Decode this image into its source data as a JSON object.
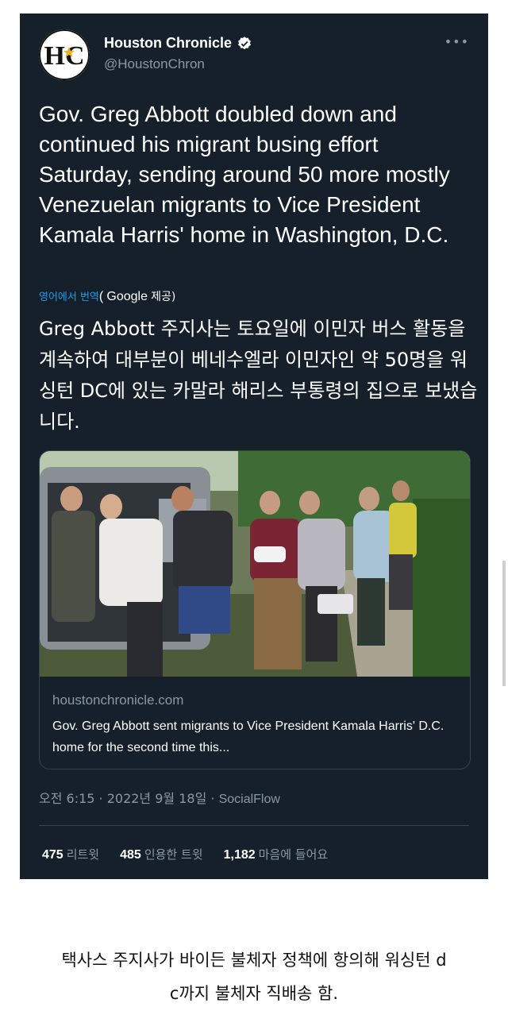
{
  "tweet": {
    "display_name": "Houston Chronicle",
    "handle": "@HoustonChron",
    "more_icon": "more-horizontal-icon",
    "avatar_text": "HC",
    "text": "Gov. Greg Abbott doubled down and continued his migrant busing effort Saturday, sending around 50 more mostly Venezuelan migrants to Vice President Kamala Harris' home in Washington, D.C.",
    "translate_label": "영어에서 번역",
    "translate_provider_open": "(",
    "translate_provider": "Google",
    "translate_provider_suffix": "제공)",
    "translated_text": "Greg Abbott 주지사는 토요일에 이민자 버스 활동을 계속하여 대부분이 베네수엘라 이민자인 약 50명을 워싱턴 DC에 있는 카말라 해리스 부통령의 집으로 보냈습니다.",
    "card": {
      "domain": "houstonchronicle.com",
      "title": "Gov. Greg Abbott sent migrants to Vice President Kamala Harris' D.C. home for the second time this..."
    },
    "meta": {
      "time_date": "오전 6:15 · 2022년 9월 18일 · ",
      "source": "SocialFlow"
    },
    "stats": {
      "retweets_count": "475",
      "retweets_label": "리트윗",
      "quotes_count": "485",
      "quotes_label": "인용한 트윗",
      "likes_count": "1,182",
      "likes_label": "마음에 들어요"
    }
  },
  "caption": {
    "line1": "택사스 주지사가 바이든 불체자 정책에 항의해 워싱턴 d",
    "line2": "c까지 불체자  직배송 함."
  },
  "colors": {
    "tweet_bg": "#15202b",
    "link_blue": "#1d9bf0",
    "muted": "#8b98a5"
  }
}
